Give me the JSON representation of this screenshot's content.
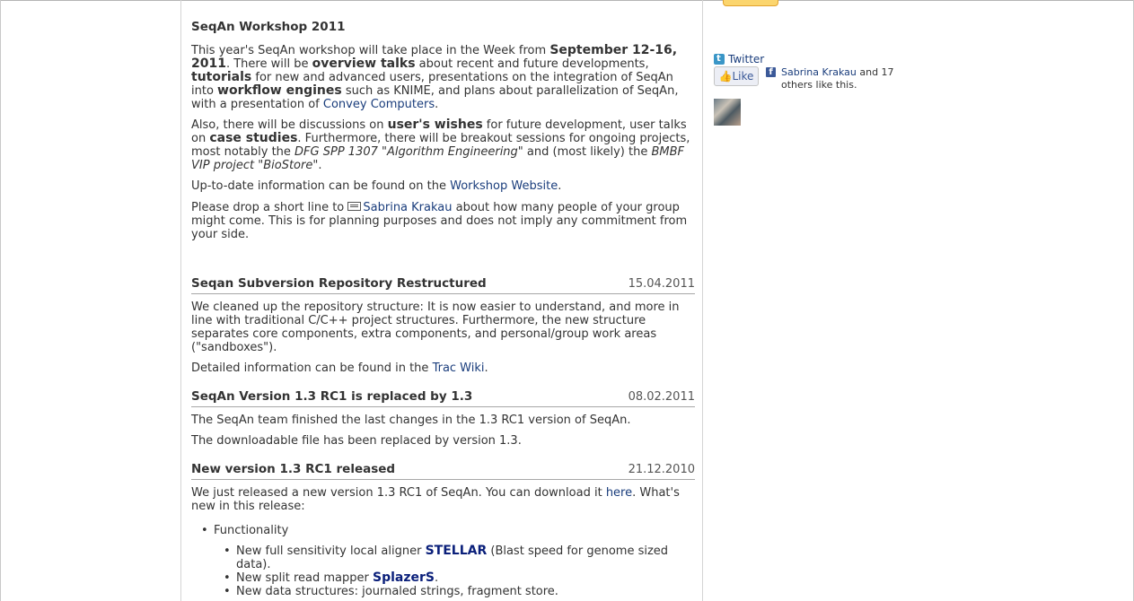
{
  "workshop": {
    "title": "SeqAn Workshop 2011",
    "p1": [
      {
        "t": "This year's SeqAn workshop will take place in the Week from "
      },
      {
        "t": "September 12-16, 2011",
        "b": true
      },
      {
        "t": ". There will be "
      },
      {
        "t": "overview talks",
        "b": true
      },
      {
        "t": " about recent and future developments, "
      },
      {
        "t": "tutorials",
        "b": true
      },
      {
        "t": " for new and advanced users, presentations on the integration of SeqAn into "
      },
      {
        "t": "workflow engines",
        "b": true
      },
      {
        "t": " such as KNIME, and plans about parallelization of SeqAn, with a presentation of "
      },
      {
        "t": "Convey Computers",
        "a": true
      },
      {
        "t": "."
      }
    ],
    "p2": [
      {
        "t": "Also, there will be discussions on "
      },
      {
        "t": "user's wishes",
        "b": true
      },
      {
        "t": " for future development, user talks on "
      },
      {
        "t": "case studies",
        "b": true
      },
      {
        "t": ". Furthermore, there will be breakout sessions for ongoing projects, most notably the "
      },
      {
        "t": "DFG SPP 1307 \"Algorithm Engineering\"",
        "i": true
      },
      {
        "t": " and (most likely) the "
      },
      {
        "t": "BMBF VIP project \"BioStore\"",
        "i": true
      },
      {
        "t": "."
      }
    ],
    "p3": [
      {
        "t": "Up-to-date information can be found on the "
      },
      {
        "t": "Workshop Website",
        "a": true
      },
      {
        "t": "."
      }
    ],
    "p4": [
      {
        "t": "Please drop a short line to "
      },
      {
        "t": "Sabrina Krakau",
        "a": true,
        "mail": true
      },
      {
        "t": " about how many people of your group might come. This is for planning purposes and does not imply any commitment from your side."
      }
    ]
  },
  "repo": {
    "title": "Seqan Subversion Repository Restructured",
    "date": "15.04.2011",
    "p1": [
      {
        "t": "We cleaned up the repository structure: It is now easier to understand, and more in line with traditional C/C++ project structures. Furthermore, the new structure separates core components, extra components, and personal/group work areas (\"sandboxes\")."
      }
    ],
    "p2": [
      {
        "t": "Detailed information can be found in the "
      },
      {
        "t": "Trac Wiki",
        "a": true
      },
      {
        "t": "."
      }
    ]
  },
  "v13": {
    "title": "SeqAn Version 1.3 RC1 is replaced by 1.3",
    "date": "08.02.2011",
    "p1": [
      {
        "t": "The SeqAn team finished the last changes in the 1.3 RC1 version of SeqAn."
      }
    ],
    "p2": [
      {
        "t": "The downloadable file has been replaced by version 1.3."
      }
    ]
  },
  "rc1": {
    "title": "New version 1.3 RC1 released",
    "date": "21.12.2010",
    "p1": [
      {
        "t": "We just released a new version 1.3 RC1 of SeqAn. You can download it "
      },
      {
        "t": "here",
        "a": true
      },
      {
        "t": ". What's new in this release:"
      }
    ],
    "list_heading": "Functionality",
    "items": [
      [
        {
          "t": "New full sensitivity local aligner "
        },
        {
          "t": "STELLAR",
          "a": true,
          "s": true
        },
        {
          "t": " (Blast speed for genome sized data)."
        }
      ],
      [
        {
          "t": "New split read mapper "
        },
        {
          "t": "SplazerS",
          "a": true,
          "s": true
        },
        {
          "t": "."
        }
      ],
      [
        {
          "t": "New data structures: journaled strings, fragment store."
        }
      ]
    ]
  },
  "sidebar": {
    "twitter_label": "Twitter",
    "like_label": "Like",
    "fb_name": "Sabrina Krakau",
    "fb_rest": " and 17 others like this."
  }
}
